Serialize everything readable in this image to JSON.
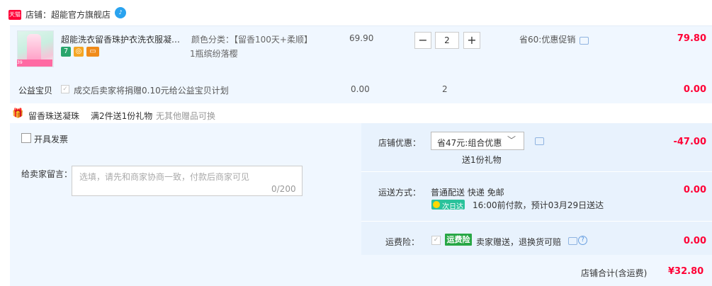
{
  "shop": {
    "badge": "天猫",
    "name": "店铺：超能官方旗舰店",
    "wang_icon": "wangwang-icon"
  },
  "item": {
    "title": "超能洗衣留香珠护衣洗衣服凝香...",
    "sku_label": "颜色分类：【留香100天+柔顺】",
    "sku_value": "1瓶缤纷落樱",
    "unit_price": "69.90",
    "quantity": "2",
    "minus_label": "−",
    "plus_label": "+",
    "promo": "省60:优惠促销",
    "subtotal": "79.80",
    "thumb_tag": "39"
  },
  "charity": {
    "label": "公益宝贝",
    "text": "成交后卖家将捐赠0.10元给公益宝贝计划",
    "price": "0.00",
    "qty": "2",
    "total": "0.00"
  },
  "gift": {
    "label": "留香珠送凝珠",
    "rule": "满2件送1份礼物",
    "none": "无其他赠品可换"
  },
  "invoice": {
    "label": "开具发票"
  },
  "message": {
    "label": "给卖家留言：",
    "placeholder": "选填，请先和商家协商一致，付款后商家可见",
    "counter": "0/200"
  },
  "discount": {
    "label": "店铺优惠：",
    "selected": "省47元:组合优惠",
    "gift_note": "送1份礼物",
    "amount": "-47.00"
  },
  "shipping": {
    "label": "运送方式：",
    "method": "普通配送 快递 免邮",
    "badge": "次日达",
    "note": "16:00前付款，预计03月29日送达",
    "fee": "0.00"
  },
  "insurance": {
    "label": "运费险：",
    "badge": "运费险",
    "text": "卖家赠送，退换货可赔",
    "fee": "0.00"
  },
  "total": {
    "label": "店铺合计(含运费)",
    "value": "¥32.80"
  },
  "colors": {
    "accent_red": "#ff0036",
    "panel_bg": "#f0f7ff",
    "badge_green": "#28a745"
  }
}
